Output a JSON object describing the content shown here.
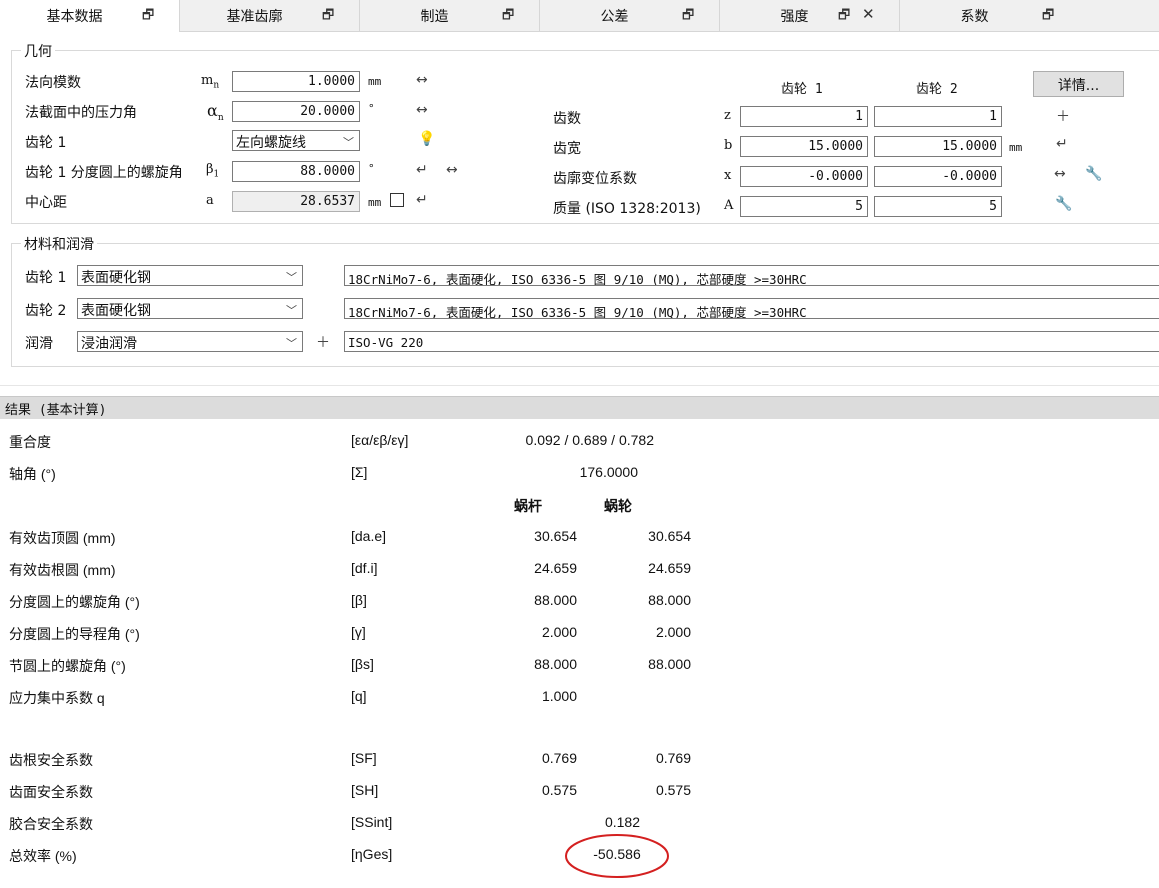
{
  "tabs": [
    {
      "label": "基本数据"
    },
    {
      "label": "基准齿廓"
    },
    {
      "label": "制造"
    },
    {
      "label": "公差"
    },
    {
      "label": "强度"
    },
    {
      "label": "系数"
    }
  ],
  "geometry": {
    "title": "几何",
    "rows": [
      {
        "label": "法向模数",
        "sym": "m",
        "sub": "n",
        "value": "1.0000",
        "unit": "mm"
      },
      {
        "label": "法截面中的压力角",
        "sym": "α",
        "sub": "n",
        "value": "20.0000",
        "unit": "°"
      },
      {
        "label": "齿轮 1",
        "select": "左向螺旋线"
      },
      {
        "label": "齿轮 1 分度圆上的螺旋角",
        "sym": "β",
        "sub": "1",
        "value": "88.0000",
        "unit": "°"
      },
      {
        "label": "中心距",
        "sym": "a",
        "value": "28.6537",
        "unit": "mm"
      }
    ],
    "col_headers": [
      "齿轮 1",
      "齿轮 2"
    ],
    "details_button": "详情...",
    "gear_rows": [
      {
        "label": "齿数",
        "sym": "z",
        "g1": "1",
        "g2": "1",
        "unit": ""
      },
      {
        "label": "齿宽",
        "sym": "b",
        "g1": "15.0000",
        "g2": "15.0000",
        "unit": "mm"
      },
      {
        "label": "齿廓变位系数",
        "sym": "x",
        "g1": "-0.0000",
        "g2": "-0.0000",
        "unit": ""
      },
      {
        "label": "质量 (ISO 1328:2013)",
        "sym": "A",
        "g1": "5",
        "g2": "5",
        "unit": ""
      }
    ]
  },
  "material": {
    "title": "材料和润滑",
    "rows": [
      {
        "label": "齿轮 1",
        "select": "表面硬化钢",
        "desc": "18CrNiMo7-6, 表面硬化, ISO 6336-5 图 9/10 (MQ), 芯部硬度 >=30HRC"
      },
      {
        "label": "齿轮 2",
        "select": "表面硬化钢",
        "desc": "18CrNiMo7-6, 表面硬化, ISO 6336-5 图 9/10 (MQ), 芯部硬度 >=30HRC"
      },
      {
        "label": "润滑",
        "select": "浸油润滑",
        "desc": "ISO-VG 220"
      }
    ]
  },
  "results": {
    "title": "结果 (基本计算)",
    "contact_ratio": {
      "label": "重合度",
      "sym": "[εα/εβ/εγ]",
      "value": "0.092 / 0.689 / 0.782"
    },
    "shaft_angle": {
      "label": "轴角 (°)",
      "sym": "[Σ]",
      "value": "176.0000"
    },
    "col_headers": [
      "蜗杆",
      "蜗轮"
    ],
    "rows": [
      {
        "label": "有效齿顶圆 (mm)",
        "sym": "[da.e]",
        "v1": "30.654",
        "v2": "30.654"
      },
      {
        "label": "有效齿根圆 (mm)",
        "sym": "[df.i]",
        "v1": "24.659",
        "v2": "24.659"
      },
      {
        "label": "分度圆上的螺旋角 (°)",
        "sym": "[β]",
        "v1": "88.000",
        "v2": "88.000"
      },
      {
        "label": "分度圆上的导程角 (°)",
        "sym": "[γ]",
        "v1": "2.000",
        "v2": "2.000"
      },
      {
        "label": "节圆上的螺旋角 (°)",
        "sym": "[βs]",
        "v1": "88.000",
        "v2": "88.000"
      },
      {
        "label": "应力集中系数 q",
        "sym": "[q]",
        "v1": "1.000",
        "v2": ""
      },
      {
        "label": "齿根安全系数",
        "sym": "[SF]",
        "v1": "0.769",
        "v2": "0.769"
      },
      {
        "label": "齿面安全系数",
        "sym": "[SH]",
        "v1": "0.575",
        "v2": "0.575"
      }
    ],
    "scuffing": {
      "label": "胶合安全系数",
      "sym": "[SSint]",
      "value": "0.182"
    },
    "efficiency": {
      "label": "总效率 (%)",
      "sym": "[ηGes]",
      "value": "-50.586"
    }
  },
  "highlight_color": "#d42020"
}
